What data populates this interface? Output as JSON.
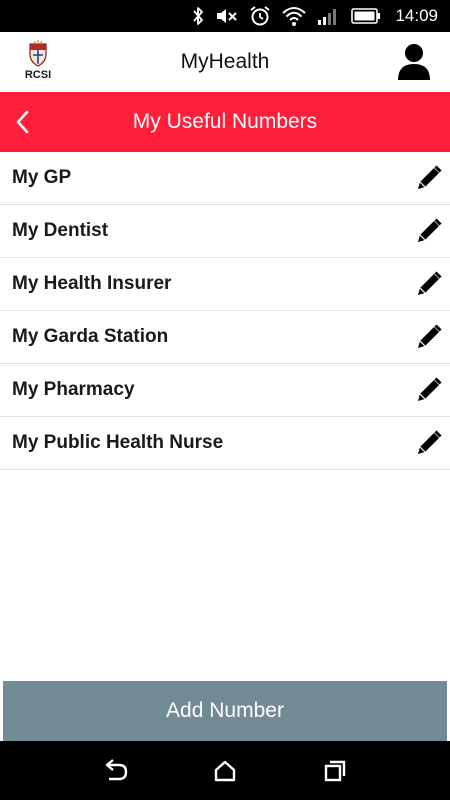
{
  "status_bar": {
    "time": "14:09",
    "icons": [
      "bluetooth-icon",
      "mute-icon",
      "alarm-icon",
      "wifi-icon",
      "signal-icon",
      "battery-icon"
    ]
  },
  "header": {
    "logo_text": "RCSI",
    "title": "MyHealth",
    "profile_icon": "person-icon"
  },
  "page": {
    "title": "My Useful Numbers",
    "back_icon": "chevron-left-icon",
    "accent_color": "#ff1f3a"
  },
  "items": [
    {
      "label": "My GP",
      "icon": "pencil-icon"
    },
    {
      "label": "My Dentist",
      "icon": "pencil-icon"
    },
    {
      "label": "My Health Insurer",
      "icon": "pencil-icon"
    },
    {
      "label": "My Garda Station",
      "icon": "pencil-icon"
    },
    {
      "label": "My Pharmacy",
      "icon": "pencil-icon"
    },
    {
      "label": "My Public Health Nurse",
      "icon": "pencil-icon"
    }
  ],
  "add_button": {
    "label": "Add Number",
    "color": "#728a95"
  },
  "nav_bar": {
    "icons": [
      "back-nav-icon",
      "home-nav-icon",
      "recents-nav-icon"
    ]
  }
}
